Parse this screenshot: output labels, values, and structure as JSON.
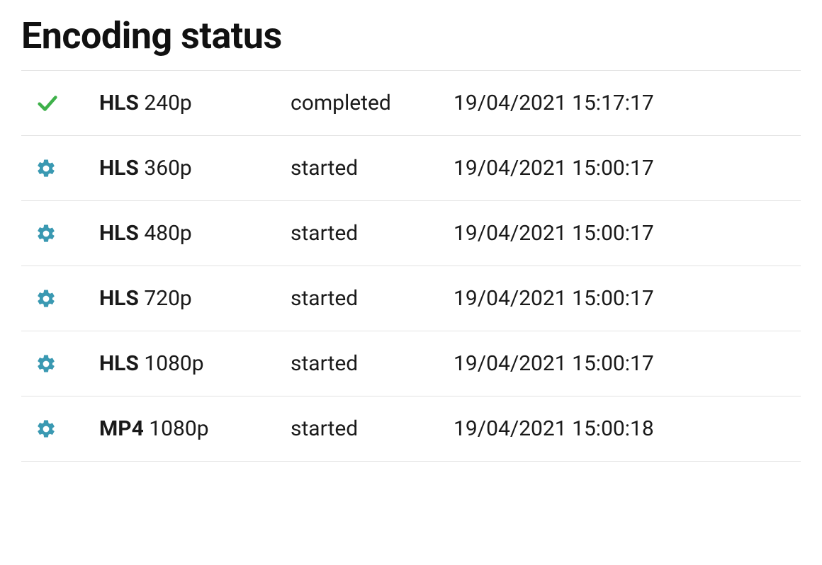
{
  "title": "Encoding status",
  "icons": {
    "completed": "check",
    "started": "gear"
  },
  "colors": {
    "check": "#3eb14a",
    "gear": "#3a99b2",
    "border": "#e3e3e3"
  },
  "rows": [
    {
      "status_icon": "check",
      "format": "HLS",
      "resolution": "240p",
      "status": "completed",
      "timestamp": "19/04/2021 15:17:17"
    },
    {
      "status_icon": "gear",
      "format": "HLS",
      "resolution": "360p",
      "status": "started",
      "timestamp": "19/04/2021 15:00:17"
    },
    {
      "status_icon": "gear",
      "format": "HLS",
      "resolution": "480p",
      "status": "started",
      "timestamp": "19/04/2021 15:00:17"
    },
    {
      "status_icon": "gear",
      "format": "HLS",
      "resolution": "720p",
      "status": "started",
      "timestamp": "19/04/2021 15:00:17"
    },
    {
      "status_icon": "gear",
      "format": "HLS",
      "resolution": "1080p",
      "status": "started",
      "timestamp": "19/04/2021 15:00:17"
    },
    {
      "status_icon": "gear",
      "format": "MP4",
      "resolution": "1080p",
      "status": "started",
      "timestamp": "19/04/2021 15:00:18"
    }
  ]
}
